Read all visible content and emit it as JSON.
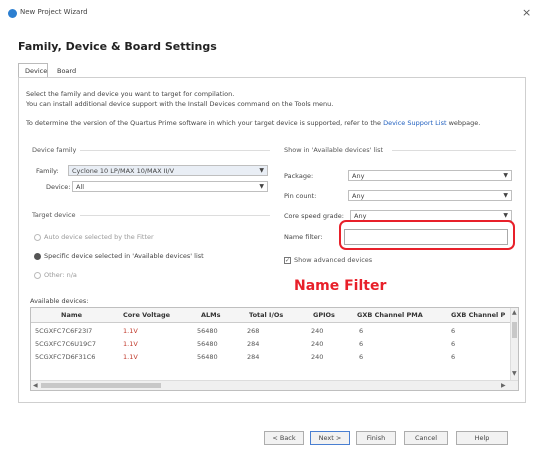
{
  "window": {
    "title": "New Project Wizard",
    "close_glyph": "×"
  },
  "page": {
    "heading": "Family, Device & Board Settings"
  },
  "tabs": [
    {
      "label": "Device",
      "active": true
    },
    {
      "label": "Board",
      "active": false
    }
  ],
  "intro": {
    "line1": "Select the family and device you want to target for compilation.",
    "line2": "You can install additional device support with the Install Devices command on the Tools menu.",
    "line3_prefix": "To determine the version of the Quartus Prime software in which your target device is supported, refer to the ",
    "line3_link": "Device Support List",
    "line3_suffix": " webpage."
  },
  "device_family": {
    "group_label": "Device family",
    "family_label": "Family:",
    "family_value": "Cyclone 10 LP/MAX 10/MAX II/V",
    "device_label": "Device:",
    "device_value": "All"
  },
  "target_device": {
    "group_label": "Target device",
    "options": [
      {
        "label": "Auto device selected by the Fitter",
        "selected": false
      },
      {
        "label": "Specific device selected in 'Available devices' list",
        "selected": true
      },
      {
        "label": "Other: n/a",
        "selected": false
      }
    ]
  },
  "show_in_list": {
    "group_label": "Show in 'Available devices' list",
    "package_label": "Package:",
    "package_value": "Any",
    "pin_count_label": "Pin count:",
    "pin_count_value": "Any",
    "speed_grade_label": "Core speed grade:",
    "speed_grade_value": "Any",
    "name_filter_label": "Name filter:",
    "name_filter_value": "",
    "show_advanced_label": "Show advanced devices",
    "show_advanced_checked": true
  },
  "annotation": {
    "label": "Name Filter",
    "color": "#e8202a"
  },
  "available_devices": {
    "label": "Available devices:",
    "columns": [
      "Name",
      "Core Voltage",
      "ALMs",
      "Total I/Os",
      "GPIOs",
      "GXB Channel PMA",
      "GXB Channel P"
    ],
    "rows": [
      [
        "5CGXFC7C6F23I7",
        "1.1V",
        "56480",
        "268",
        "240",
        "6",
        "6"
      ],
      [
        "5CGXFC7C6U19C7",
        "1.1V",
        "56480",
        "284",
        "240",
        "6",
        "6"
      ],
      [
        "5CGXFC7D6F31C6",
        "1.1V",
        "56480",
        "284",
        "240",
        "6",
        "6"
      ]
    ]
  },
  "buttons": {
    "back": "< Back",
    "next": "Next >",
    "finish": "Finish",
    "cancel": "Cancel",
    "help": "Help"
  }
}
